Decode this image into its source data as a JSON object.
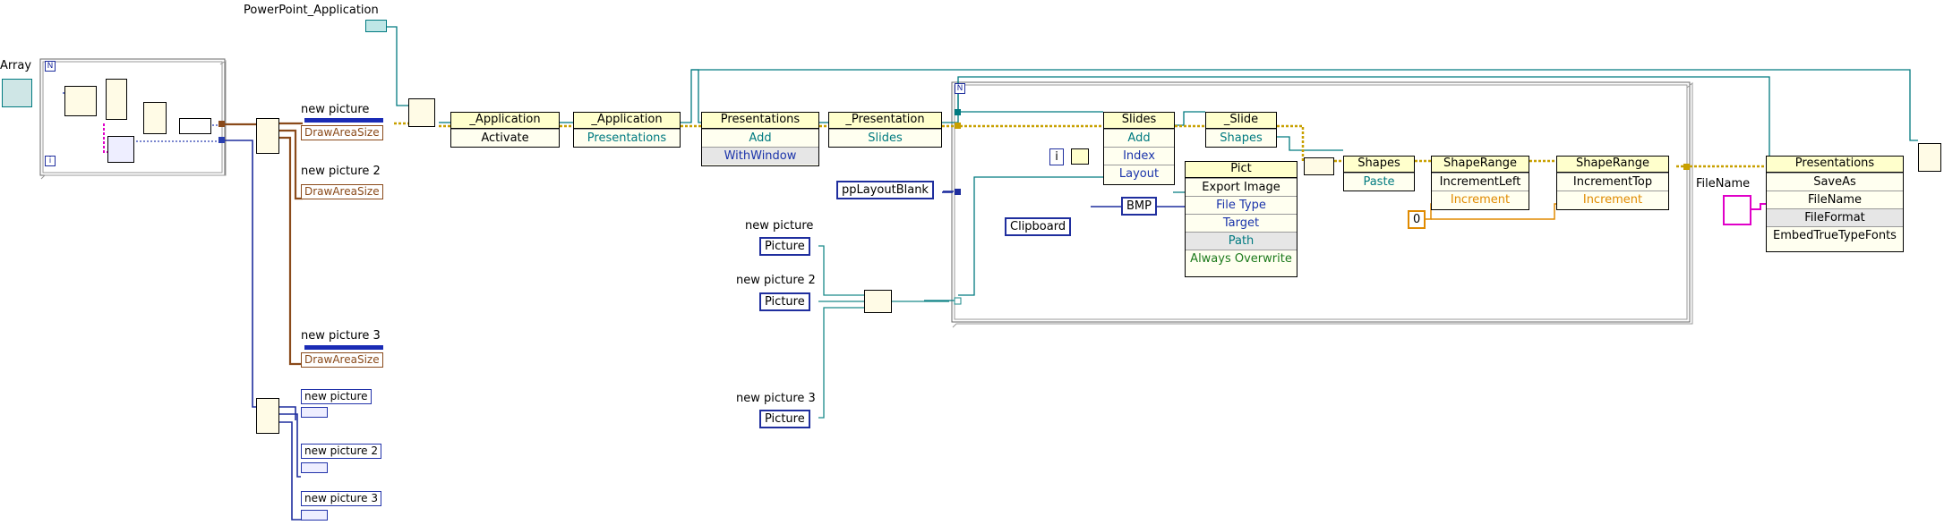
{
  "labels": {
    "array": "Array",
    "ppt_app": "PowerPoint_Application",
    "file_name": "FileName",
    "new_picture": "new picture",
    "new_picture_2": "new picture 2",
    "new_picture_3": "new picture 3"
  },
  "constants": {
    "layout": "ppLayoutBlank",
    "filetype": "BMP",
    "target": "Clipboard",
    "zero": "0",
    "picture": "Picture",
    "picture2": "Picture",
    "picture3": "Picture",
    "index_i": "i",
    "loop_n": "N",
    "loop_i": "i"
  },
  "property_nodes": [
    {
      "title": "DrawAreaSize"
    },
    {
      "title": "DrawAreaSize"
    },
    {
      "title": "DrawAreaSize"
    }
  ],
  "nodes": {
    "activate": {
      "title": "_Application",
      "rows": [
        "Activate"
      ]
    },
    "application": {
      "title": "_Application",
      "rows": [
        "Presentations"
      ]
    },
    "presentations_add": {
      "title": "Presentations",
      "rows": [
        "Add",
        "WithWindow"
      ]
    },
    "presentation_slides": {
      "title": "_Presentation",
      "rows": [
        "Slides"
      ]
    },
    "slides": {
      "title": "Slides",
      "rows": [
        "Add",
        "Index",
        "Layout"
      ]
    },
    "slide": {
      "title": "_Slide",
      "rows": [
        "Shapes"
      ]
    },
    "pict": {
      "title": "Pict",
      "rows": [
        "Export Image",
        "File Type",
        "Target",
        "Path",
        "Always Overwrite"
      ]
    },
    "shapes": {
      "title": "Shapes",
      "rows": [
        "Paste"
      ]
    },
    "shaperange_left": {
      "title": "ShapeRange",
      "rows": [
        "IncrementLeft",
        "Increment"
      ]
    },
    "shaperange_top": {
      "title": "ShapeRange",
      "rows": [
        "IncrementTop",
        "Increment"
      ]
    },
    "presentations_saveas": {
      "title": "Presentations",
      "rows": [
        "SaveAs",
        "FileName",
        "FileFormat",
        "EmbedTrueTypeFonts"
      ]
    }
  },
  "colors": {
    "refnum": "#007a80",
    "cluster": "#8a4a1a",
    "error": "#c8a000",
    "blue_wire": "#1f2e9e",
    "orange_wire": "#e08a00",
    "pink_wire": "#e000c8"
  }
}
